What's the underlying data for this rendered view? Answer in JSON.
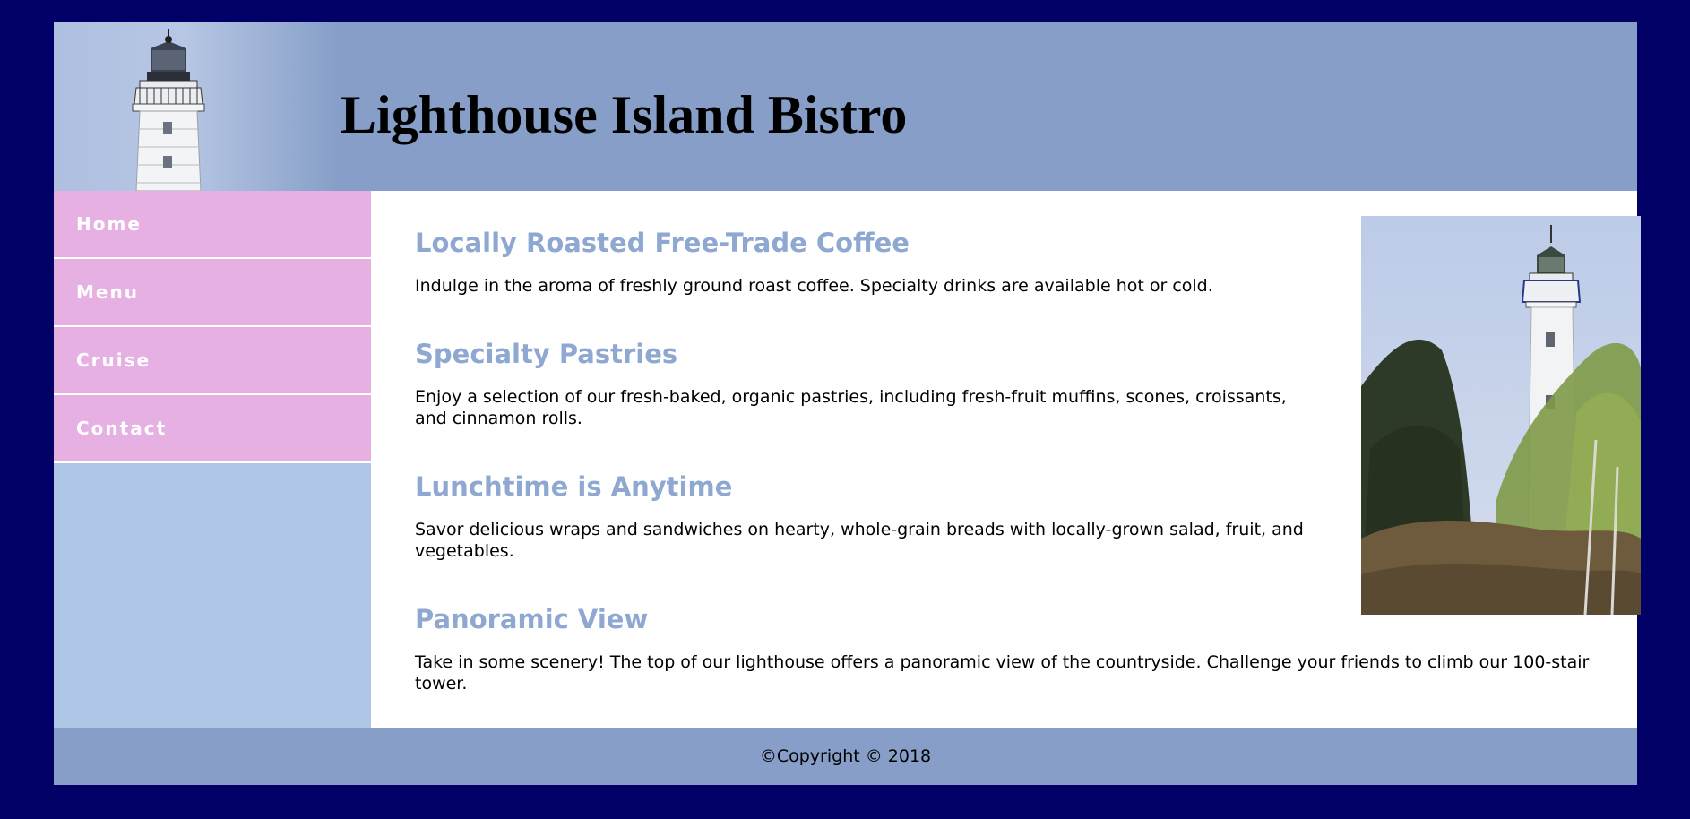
{
  "site": {
    "title": "Lighthouse Island Bistro"
  },
  "nav": {
    "items": [
      {
        "label": "Home"
      },
      {
        "label": "Menu"
      },
      {
        "label": "Cruise"
      },
      {
        "label": "Contact"
      }
    ]
  },
  "main": {
    "sections": [
      {
        "heading": "Locally Roasted Free-Trade Coffee",
        "text": "Indulge in the aroma of freshly ground roast coffee. Specialty drinks are available hot or cold."
      },
      {
        "heading": "Specialty Pastries",
        "text": "Enjoy a selection of our fresh-baked, organic pastries, including fresh-fruit muffins, scones, croissants, and cinnamon rolls."
      },
      {
        "heading": "Lunchtime is Anytime",
        "text": "Savor delicious wraps and sandwiches on hearty, whole-grain breads with locally-grown salad, fruit, and vegetables."
      },
      {
        "heading": "Panoramic View",
        "text": "Take in some scenery! The top of our lighthouse offers a panoramic view of the countryside. Challenge your friends to climb our 100-stair tower."
      }
    ]
  },
  "footer": {
    "copyright": "©Copyright © 2018"
  },
  "colors": {
    "page_background": "#000066",
    "header_background": "#869ec8",
    "nav_item_background": "#e6b0e3",
    "nav_background": "#b0c6e6",
    "heading_color": "#8fa8d2"
  }
}
